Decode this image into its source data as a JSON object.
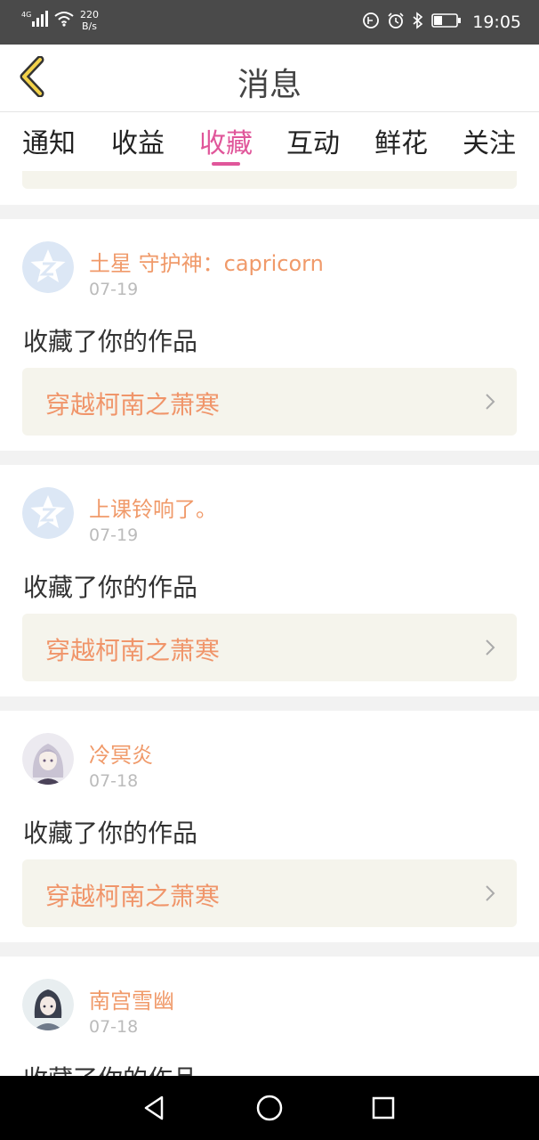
{
  "status_bar": {
    "network": "4G",
    "speed_value": "220",
    "speed_unit": "B/s",
    "time": "19:05",
    "icons": [
      "signal-icon",
      "wifi-icon",
      "hd-icon",
      "alarm-icon",
      "bluetooth-icon",
      "battery-icon"
    ]
  },
  "header": {
    "title": "消息",
    "back_icon": "back-chevron-icon"
  },
  "tabs": [
    {
      "label": "通知"
    },
    {
      "label": "收益"
    },
    {
      "label": "收藏"
    },
    {
      "label": "互动"
    },
    {
      "label": "鲜花"
    },
    {
      "label": "关注"
    }
  ],
  "active_tab": 2,
  "messages": [
    {
      "username": "土星 守护神：capricorn",
      "date": "07-19",
      "action": "收藏了你的作品",
      "work_title": "穿越柯南之萧寒",
      "avatar": "default-avatar-icon"
    },
    {
      "username": "上课铃响了。",
      "date": "07-19",
      "action": "收藏了你的作品",
      "work_title": "穿越柯南之萧寒",
      "avatar": "default-avatar-icon"
    },
    {
      "username": "冷冥炎",
      "date": "07-18",
      "action": "收藏了你的作品",
      "work_title": "穿越柯南之萧寒",
      "avatar": "user-photo-avatar"
    },
    {
      "username": "南宫雪幽",
      "date": "07-18",
      "action": "收藏了你的作品",
      "work_title": "",
      "avatar": "user-photo-avatar"
    }
  ],
  "colors": {
    "accent": "#e0569a",
    "username": "#f09a6a",
    "work_bg": "#f5f4ec",
    "status_bar": "#4a4a4a"
  },
  "nav_bar": {
    "icons": [
      "nav-back-icon",
      "nav-home-icon",
      "nav-recents-icon"
    ]
  }
}
